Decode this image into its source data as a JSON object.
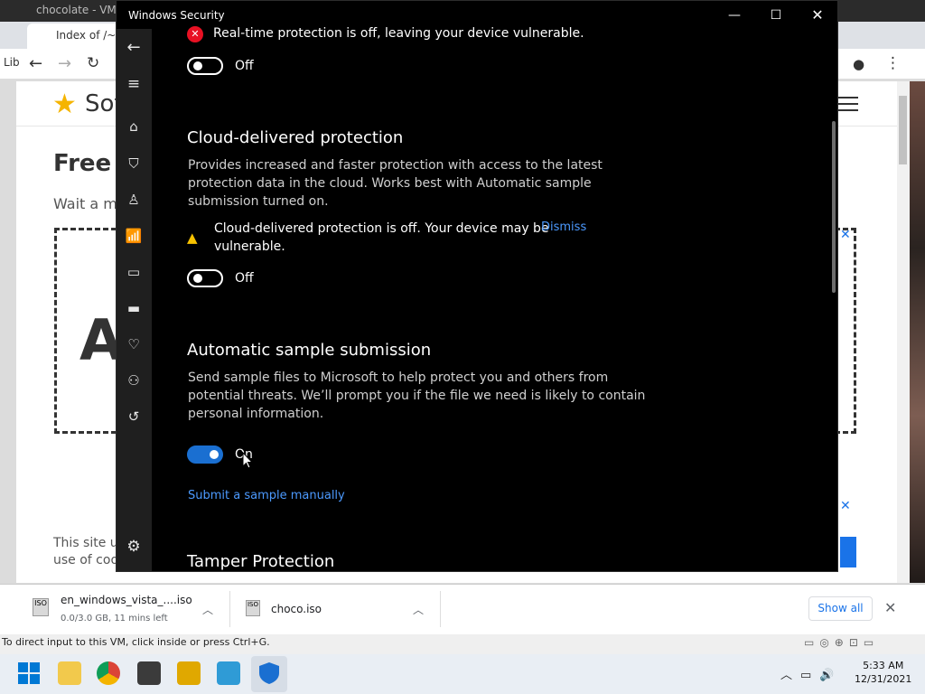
{
  "vm": {
    "title": "chocolate - VM",
    "status_text": "To direct input to this VM, click inside or press Ctrl+G."
  },
  "browser": {
    "tab_title": "Index of /~d",
    "bookmark_letter": "Lib",
    "site_name": "Sof",
    "heading": "Free S",
    "wait_text": "Wait a m",
    "ad_letter": "A",
    "site_notice_1": "This site us",
    "site_notice_2": "use of cook"
  },
  "downloads": {
    "items": [
      {
        "name": "en_windows_vista_....iso",
        "sub": "0.0/3.0 GB, 11 mins left"
      },
      {
        "name": "choco.iso",
        "sub": ""
      }
    ],
    "show_all": "Show all"
  },
  "security": {
    "window_title": "Windows Security",
    "realtime_msg": "Real-time protection is off, leaving your device vulnerable.",
    "realtime_toggle": "Off",
    "cloud": {
      "title": "Cloud-delivered protection",
      "desc": [
        "Provides increased and faster protection with access to the latest",
        "protection data in the cloud. Works best with Automatic sample",
        "submission turned on."
      ],
      "warning_line1": "Cloud-delivered protection is off. Your device may be",
      "warning_line2": "vulnerable.",
      "dismiss": "Dismiss",
      "toggle": "Off"
    },
    "auto_sample": {
      "title": "Automatic sample submission",
      "desc": [
        "Send sample files to Microsoft to help protect you and others from",
        "potential threats. We’ll prompt you if the file we need is likely to contain",
        "personal information."
      ],
      "toggle": "On",
      "submit_link": "Submit a sample manually"
    },
    "tamper": {
      "title": "Tamper Protection"
    }
  },
  "taskbar": {
    "time": "5:33 AM",
    "date": "12/31/2021"
  },
  "colors": {
    "accent": "#1a6fd1",
    "link": "#4c9aff",
    "error": "#e81123",
    "warning": "#f7c200"
  }
}
